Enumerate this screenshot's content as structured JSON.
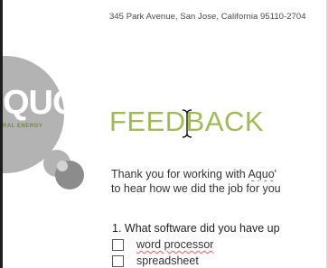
{
  "document": {
    "address": "345 Park Avenue, San Jose, California 95110-2704",
    "heading": "FEEDBACK",
    "intro_line1_before": "Thank you for working with ",
    "intro_line1_highlight": "Aquo",
    "intro_line1_after": "'",
    "intro_line2": "to hear how we did the job for you",
    "question": "1. What software did you have up",
    "options": [
      {
        "label": "word processor",
        "squiggle": true
      },
      {
        "label": "spreadsheet",
        "squiggle": false
      }
    ]
  },
  "logo": {
    "wordmark": "QUO",
    "tagline": "RAL ENERGY"
  },
  "colors": {
    "heading_green": "#9fba58",
    "logo_gray": "#b3b3b3",
    "spell_error": "#e25b5b"
  },
  "icons": {
    "cursor": "ibeam-cursor-icon"
  }
}
